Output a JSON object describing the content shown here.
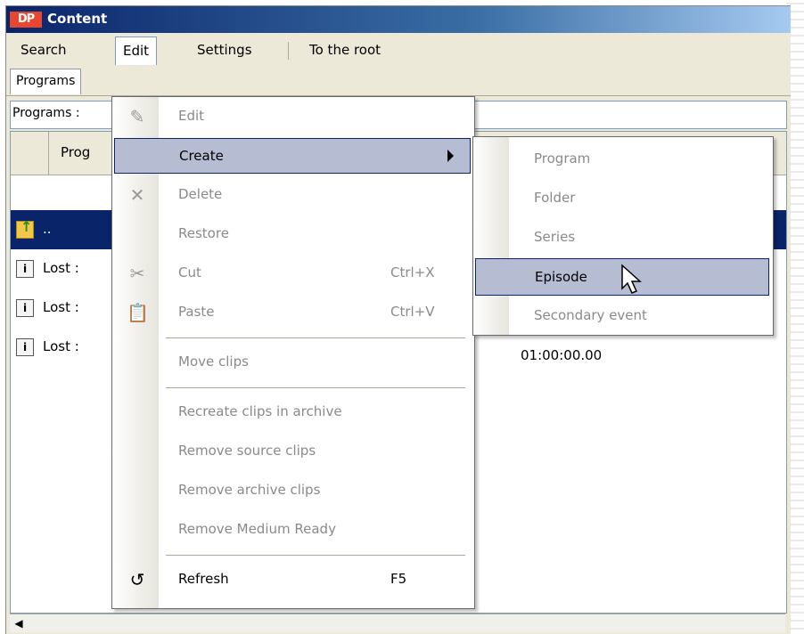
{
  "window": {
    "title": "Content",
    "logo_text": "DP"
  },
  "menubar": {
    "items": [
      "Search",
      "Edit",
      "Settings",
      "To the root"
    ],
    "active": "Edit"
  },
  "tabs": {
    "items": [
      "Programs"
    ]
  },
  "pathbar": {
    "label": "Programs :"
  },
  "grid": {
    "column": "Prog",
    "rows": [
      {
        "name": "..",
        "icon": "folder-up-icon",
        "selected": true
      },
      {
        "name": "Lost :",
        "icon": "info-document-icon",
        "selected": false
      },
      {
        "name": "Lost :",
        "icon": "info-document-icon",
        "selected": false
      },
      {
        "name": "Lost :",
        "icon": "info-document-icon",
        "selected": false
      }
    ],
    "time_value": "01:00:00.00"
  },
  "edit_menu": {
    "items": [
      {
        "label": "Edit",
        "icon": "edit-icon",
        "enabled": false
      },
      {
        "label": "Create",
        "enabled": true,
        "highlighted": true,
        "has_submenu": true
      },
      {
        "label": "Delete",
        "icon": "delete-x-icon",
        "enabled": false
      },
      {
        "label": "Restore",
        "enabled": false
      },
      {
        "label": "Cut",
        "shortcut": "Ctrl+X",
        "icon": "scissors-icon",
        "enabled": false
      },
      {
        "label": "Paste",
        "shortcut": "Ctrl+V",
        "icon": "clipboard-icon",
        "enabled": false
      },
      {
        "label": "Move clips",
        "enabled": false
      },
      {
        "label": "Recreate clips in archive",
        "enabled": false
      },
      {
        "label": "Remove source clips",
        "enabled": false
      },
      {
        "label": "Remove archive clips",
        "enabled": false
      },
      {
        "label": "Remove Medium Ready",
        "enabled": false
      },
      {
        "label": "Refresh",
        "shortcut": "F5",
        "icon": "refresh-icon",
        "enabled": true
      }
    ]
  },
  "create_submenu": {
    "items": [
      {
        "label": "Program",
        "enabled": false
      },
      {
        "label": "Folder",
        "enabled": false
      },
      {
        "label": "Series",
        "enabled": false
      },
      {
        "label": "Episode",
        "enabled": true,
        "highlighted": true
      },
      {
        "label": "Secondary event",
        "enabled": false
      }
    ]
  },
  "colors": {
    "selection": "#0a246a",
    "menu_highlight": "#b6bdd2",
    "title_start": "#0a246a",
    "logo": "#e8462e"
  }
}
